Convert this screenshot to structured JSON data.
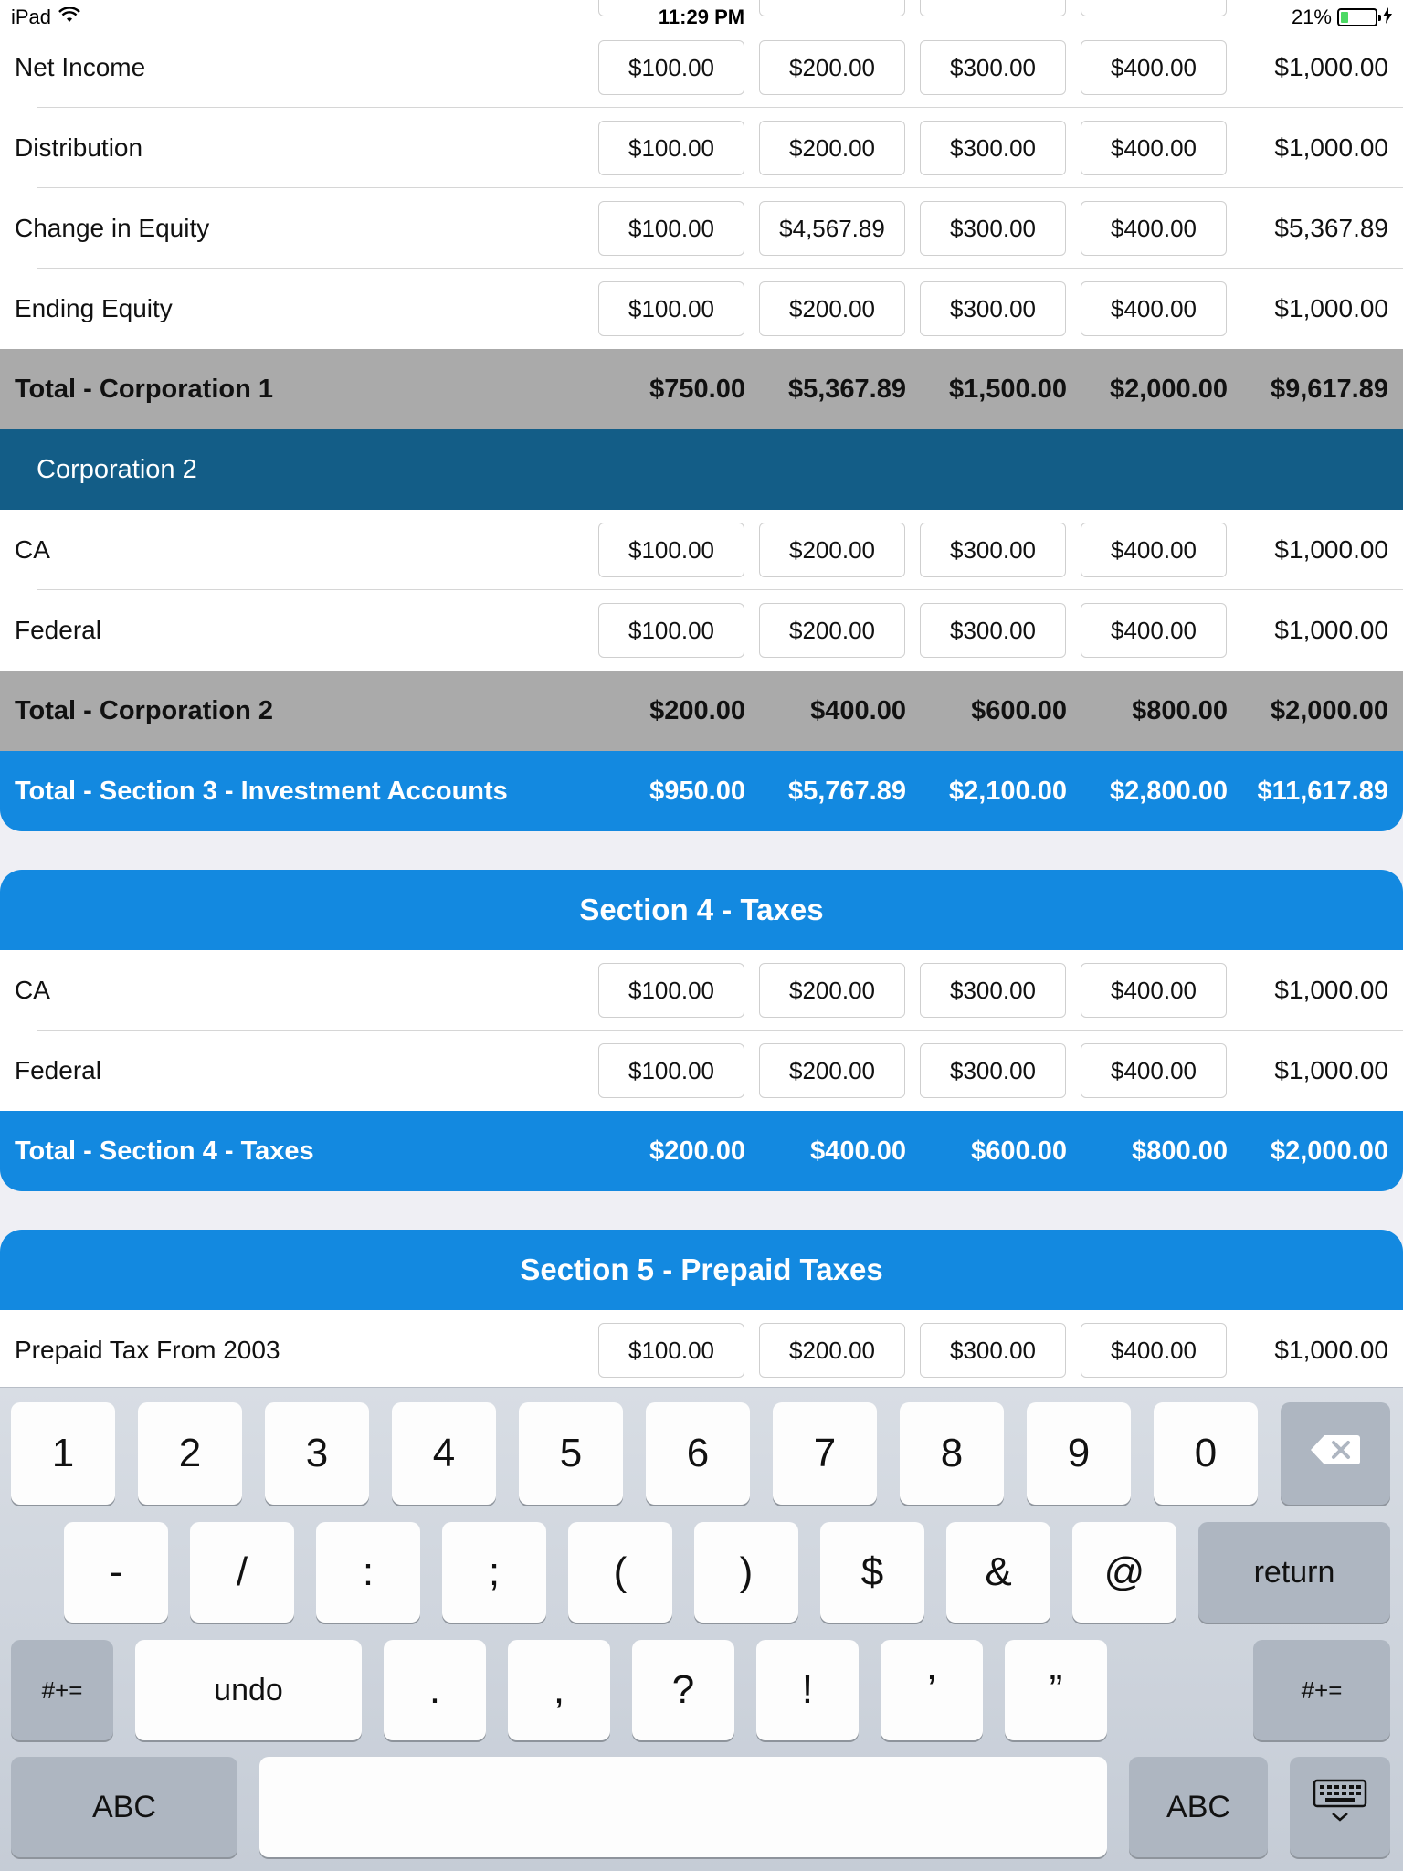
{
  "status_bar": {
    "device": "iPad",
    "time": "11:29 PM",
    "battery": "21%",
    "battery_level": 0.21
  },
  "rows_top": [
    {
      "label": "Net Income",
      "values": [
        "$100.00",
        "$200.00",
        "$300.00",
        "$400.00"
      ],
      "total": "$1,000.00"
    },
    {
      "label": "Distribution",
      "values": [
        "$100.00",
        "$200.00",
        "$300.00",
        "$400.00"
      ],
      "total": "$1,000.00"
    },
    {
      "label": "Change in Equity",
      "values": [
        "$100.00",
        "$4,567.89",
        "$300.00",
        "$400.00"
      ],
      "total": "$5,367.89"
    },
    {
      "label": "Ending Equity",
      "values": [
        "$100.00",
        "$200.00",
        "$300.00",
        "$400.00"
      ],
      "total": "$1,000.00"
    }
  ],
  "total_corp1": {
    "label": "Total - Corporation 1",
    "values": [
      "$750.00",
      "$5,367.89",
      "$1,500.00",
      "$2,000.00",
      "$9,617.89"
    ]
  },
  "corp2": {
    "title": "Corporation 2",
    "rows": [
      {
        "label": "CA",
        "values": [
          "$100.00",
          "$200.00",
          "$300.00",
          "$400.00"
        ],
        "total": "$1,000.00"
      },
      {
        "label": "Federal",
        "values": [
          "$100.00",
          "$200.00",
          "$300.00",
          "$400.00"
        ],
        "total": "$1,000.00"
      }
    ],
    "total": {
      "label": "Total - Corporation 2",
      "values": [
        "$200.00",
        "$400.00",
        "$600.00",
        "$800.00",
        "$2,000.00"
      ]
    }
  },
  "section3_total": {
    "label": "Total - Section 3 - Investment Accounts",
    "values": [
      "$950.00",
      "$5,767.89",
      "$2,100.00",
      "$2,800.00",
      "$11,617.89"
    ]
  },
  "section4": {
    "title": "Section 4 - Taxes",
    "rows": [
      {
        "label": "CA",
        "values": [
          "$100.00",
          "$200.00",
          "$300.00",
          "$400.00"
        ],
        "total": "$1,000.00"
      },
      {
        "label": "Federal",
        "values": [
          "$100.00",
          "$200.00",
          "$300.00",
          "$400.00"
        ],
        "total": "$1,000.00"
      }
    ],
    "total": {
      "label": "Total - Section 4 - Taxes",
      "values": [
        "$200.00",
        "$400.00",
        "$600.00",
        "$800.00",
        "$2,000.00"
      ]
    }
  },
  "section5": {
    "title": "Section 5 - Prepaid Taxes",
    "rows": [
      {
        "label": "Prepaid Tax From 2003",
        "values": [
          "$100.00",
          "$200.00",
          "$300.00",
          "$400.00"
        ],
        "total": "$1,000.00"
      }
    ]
  },
  "keyboard": {
    "row1": [
      "1",
      "2",
      "3",
      "4",
      "5",
      "6",
      "7",
      "8",
      "9",
      "0"
    ],
    "row2": [
      "-",
      "/",
      ":",
      ";",
      "(",
      ")",
      "$",
      "&",
      "@"
    ],
    "return_label": "return",
    "row3_left": "#+=",
    "undo_label": "undo",
    "row3": [
      ".",
      ",",
      "?",
      "!",
      "’",
      "”"
    ],
    "row3_right": "#+=",
    "abc_left": "ABC",
    "abc_right": "ABC"
  },
  "colors": {
    "section_blue": "#1389e0",
    "corp_header": "#135d87",
    "total_gray": "#aaaaaa"
  }
}
